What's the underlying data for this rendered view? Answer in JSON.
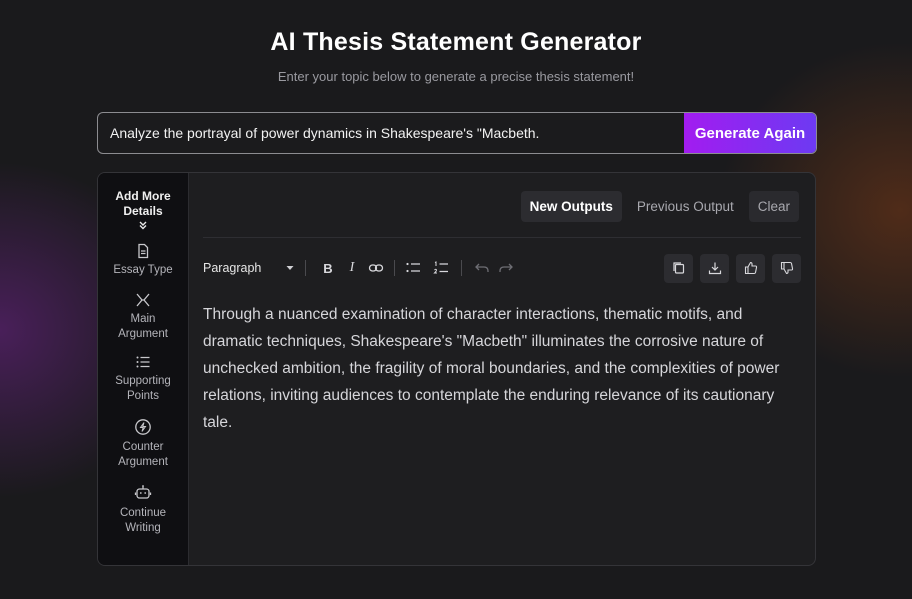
{
  "header": {
    "title": "AI Thesis Statement Generator",
    "subtitle": "Enter your topic below to generate a precise thesis statement!"
  },
  "topic": {
    "value": "Analyze the portrayal of power dynamics in Shakespeare's \"Macbeth.",
    "button_label": "Generate Again"
  },
  "sidebar": {
    "heading": "Add More Details",
    "items": [
      {
        "label": "Essay Type",
        "icon": "document-icon"
      },
      {
        "label": "Main Argument",
        "icon": "split-arrows-icon"
      },
      {
        "label": "Supporting Points",
        "icon": "list-icon"
      },
      {
        "label": "Counter Argument",
        "icon": "lightning-icon"
      },
      {
        "label": "Continue Writing",
        "icon": "robot-icon"
      }
    ]
  },
  "tabs": {
    "new_outputs": "New Outputs",
    "previous_output": "Previous Output",
    "clear": "Clear"
  },
  "toolbar": {
    "block_format": "Paragraph",
    "bold": "B",
    "italic": "I"
  },
  "output": {
    "text": "Through a nuanced examination of character interactions, thematic motifs, and dramatic techniques, Shakespeare's \"Macbeth\" illuminates the corrosive nature of unchecked ambition, the fragility of moral boundaries, and the complexities of power relations, inviting audiences to contemplate the enduring relevance of its cautionary tale."
  },
  "colors": {
    "accent_start": "#a21cf0",
    "accent_end": "#6d3af2",
    "background": "#1a1a1c",
    "panel": "#1e1e20",
    "sidebar": "#0f0f12"
  }
}
